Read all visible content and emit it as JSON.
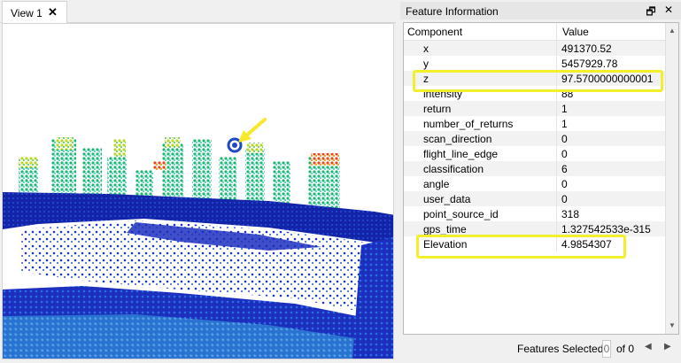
{
  "view": {
    "tab_label": "View 1",
    "close_glyph": "✕"
  },
  "panel": {
    "title": "Feature Information",
    "float_glyph": "🗗",
    "close_glyph": "✕",
    "columns": [
      "Component",
      "Value"
    ],
    "rows": [
      {
        "name": "x",
        "value": "491370.52"
      },
      {
        "name": "y",
        "value": "5457929.78"
      },
      {
        "name": "z",
        "value": "97.5700000000001"
      },
      {
        "name": "intensity",
        "value": "88"
      },
      {
        "name": "return",
        "value": "1"
      },
      {
        "name": "number_of_returns",
        "value": "1"
      },
      {
        "name": "scan_direction",
        "value": "0"
      },
      {
        "name": "flight_line_edge",
        "value": "0"
      },
      {
        "name": "classification",
        "value": "6"
      },
      {
        "name": "angle",
        "value": "0"
      },
      {
        "name": "user_data",
        "value": "0"
      },
      {
        "name": "point_source_id",
        "value": "318"
      },
      {
        "name": "gps_time",
        "value": "1.327542533e-315"
      },
      {
        "name": "Elevation",
        "value": "4.9854307"
      }
    ],
    "highlight_color": "#f2ef2c"
  },
  "footer": {
    "label": "Features Selected:",
    "current": "0",
    "total_text": "of 0",
    "prev_glyph": "◀",
    "next_glyph": "▶"
  },
  "colors": {
    "arrow": "#f5e92a",
    "point_low": "#1a2fc8",
    "point_mid": "#18b36e",
    "point_high": "#e8401c"
  }
}
